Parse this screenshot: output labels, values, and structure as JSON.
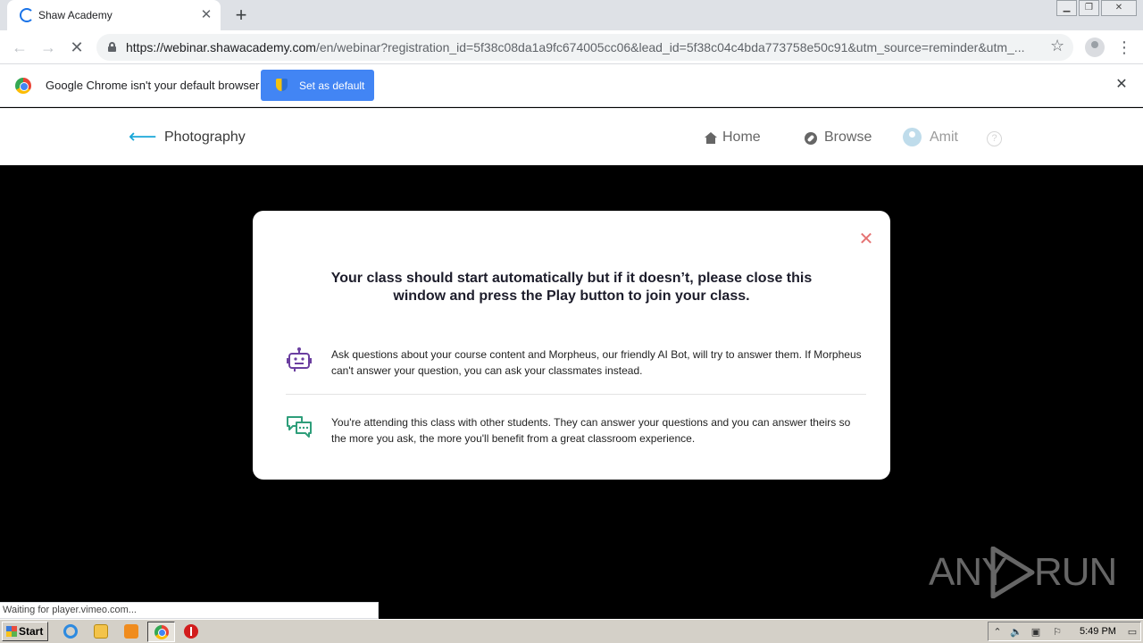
{
  "browser": {
    "tab_title": "Shaw Academy",
    "new_tab_symbol": "+",
    "url_host": "https://webinar.shawacademy.com",
    "url_rest": "/en/webinar?registration_id=5f38c08da1a9fc674005cc06&lead_id=5f38c04c4bda773758e50c91&utm_source=reminder&utm_...",
    "infobar_text": "Google Chrome isn't your default browser",
    "infobar_button": "Set as default",
    "status": "Waiting for player.vimeo.com..."
  },
  "site": {
    "course_title": "Photography",
    "nav": [
      {
        "label": "Home",
        "icon": "home-icon"
      },
      {
        "label": "Browse",
        "icon": "compass-icon"
      },
      {
        "label": "Amit",
        "icon": "user-avatar"
      }
    ],
    "help_symbol": "?"
  },
  "modal": {
    "heading_line1": "Your class should start automatically but if it doesn’t, please close this",
    "heading_line2": "window and press the Play button to join your class.",
    "tips": [
      {
        "icon": "robot-icon",
        "text": "Ask questions about your course content and Morpheus, our friendly AI Bot, will try to answer them. If Morpheus can't answer your question, you can ask your classmates instead."
      },
      {
        "icon": "chat-bubbles-icon",
        "text": "You're attending this class with other students. They can answer your questions and you can answer theirs so the more you ask, the more you'll benefit from a great classroom experience."
      }
    ],
    "accent_purple": "#6b3fa0",
    "accent_green": "#2e9e7a"
  },
  "watermark": {
    "left": "ANY",
    "right": "RUN"
  },
  "taskbar": {
    "start_label": "Start",
    "clock": "5:49 PM"
  }
}
